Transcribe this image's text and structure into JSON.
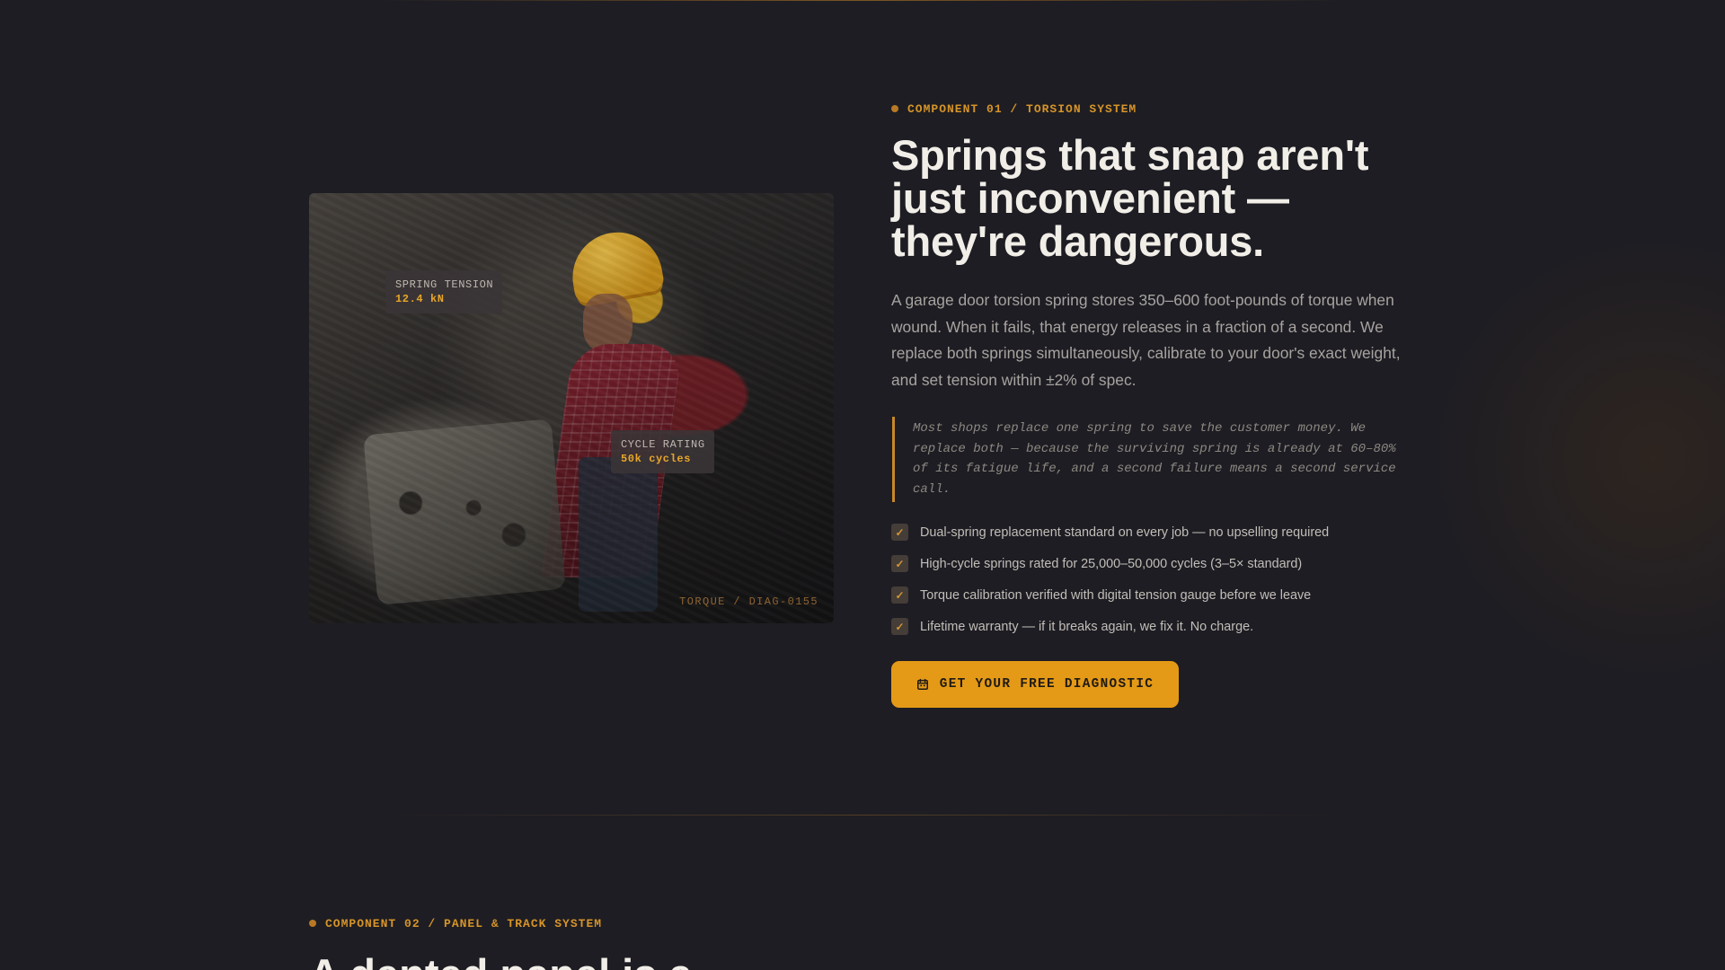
{
  "component_01": {
    "eyebrow": "COMPONENT 01 / TORSION SYSTEM",
    "headline": "Springs that snap aren't just inconvenient — they're dangerous.",
    "body": "A garage door torsion spring stores 350–600 foot-pounds of torque when wound. When it fails, that energy releases in a fraction of a second. We replace both springs simultaneously, calibrate to your door's exact weight, and set tension within ±2% of spec.",
    "quote": "Most shops replace one spring to save the customer money. We replace both — because the surviving spring is already at 60–80% of its fatigue life, and a second failure means a second service call.",
    "checklist": [
      {
        "text": "Dual-spring replacement standard on every job — no upselling required",
        "icon": "check-icon"
      },
      {
        "text": "High-cycle springs rated for 25,000–50,000 cycles (3–5× standard)",
        "icon": "check-icon"
      },
      {
        "text": "Torque calibration verified with digital tension gauge before we leave",
        "icon": "check-icon"
      },
      {
        "text": "Lifetime warranty — if it breaks again, we fix it. No charge.",
        "icon": "check-icon"
      }
    ],
    "cta": {
      "label": "GET YOUR FREE DIAGNOSTIC",
      "icon": "calendar-icon"
    }
  },
  "photo": {
    "spring_tension_label": "SPRING TENSION",
    "spring_tension_value": "12.4 kN",
    "cycle_rating_label": "CYCLE RATING",
    "cycle_rating_value": "50k cycles",
    "caption": "TORQUE / DIAG-0155"
  },
  "component_02": {
    "eyebrow": "COMPONENT 02 / PANEL & TRACK SYSTEM",
    "headline_visible": "A dented panel is a"
  },
  "colors": {
    "background": "#1e1d23",
    "accent": "#e49a17",
    "muted_text": "#a7a39f"
  }
}
